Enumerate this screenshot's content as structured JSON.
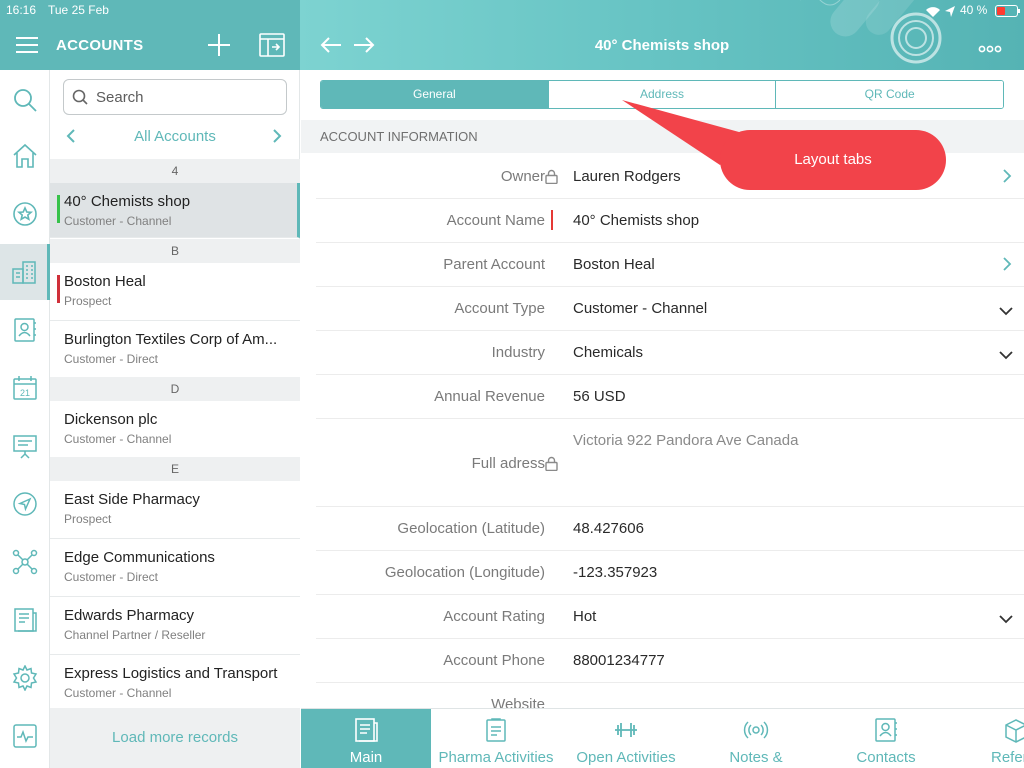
{
  "status_bar": {
    "time": "16:16",
    "date": "Tue 25 Feb",
    "battery": "40 %"
  },
  "header": {
    "left_title": "ACCOUNTS",
    "detail_title": "40° Chemists shop"
  },
  "list": {
    "search_placeholder": "Search",
    "filter_label": "All Accounts",
    "sections": [
      "4",
      "B",
      "D",
      "E"
    ],
    "rows": [
      {
        "name": "40° Chemists shop",
        "sub": "Customer - Channel"
      },
      {
        "name": "Boston Heal",
        "sub": "Prospect"
      },
      {
        "name": "Burlington Textiles Corp of Am...",
        "sub": "Customer - Direct"
      },
      {
        "name": "Dickenson plc",
        "sub": "Customer - Channel"
      },
      {
        "name": "East Side Pharmacy",
        "sub": "Prospect"
      },
      {
        "name": "Edge Communications",
        "sub": "Customer - Direct"
      },
      {
        "name": "Edwards Pharmacy",
        "sub": "Channel Partner / Reseller"
      },
      {
        "name": "Express Logistics and Transport",
        "sub": "Customer - Channel"
      }
    ],
    "load_more": "Load more records"
  },
  "tabs": [
    "General",
    "Address",
    "QR Code"
  ],
  "section_title": "ACCOUNT INFORMATION",
  "fields": [
    {
      "label": "Owner",
      "value": "Lauren Rodgers"
    },
    {
      "label": "Account Name",
      "value": "40° Chemists shop"
    },
    {
      "label": "Parent Account",
      "value": "Boston Heal"
    },
    {
      "label": "Account Type",
      "value": "Customer - Channel"
    },
    {
      "label": "Industry",
      "value": "Chemicals"
    },
    {
      "label": "Annual Revenue",
      "value": "56 USD"
    },
    {
      "label": "Full adress",
      "value": "Victoria 922 Pandora Ave Canada"
    },
    {
      "label": "Geolocation (Latitude)",
      "value": "48.427606"
    },
    {
      "label": "Geolocation (Longitude)",
      "value": "-123.357923"
    },
    {
      "label": "Account Rating",
      "value": "Hot"
    },
    {
      "label": "Account Phone",
      "value": "88001234777"
    },
    {
      "label": "Website",
      "value": ""
    }
  ],
  "callout": "Layout tabs",
  "bottom_tabs": [
    "Main",
    "Pharma Activities",
    "Open Activities",
    "Notes &",
    "Contacts",
    "Referer"
  ],
  "colors": {
    "teal": "#5fb8b8",
    "callout_red": "#f2434a",
    "required_red": "#e53935",
    "prospect_red": "#d0303a",
    "active_green": "#37c24a"
  },
  "icons": {
    "rail": [
      "search-icon",
      "home-icon",
      "favorites-icon",
      "accounts-icon",
      "contacts-icon",
      "calendar-icon",
      "presentation-icon",
      "navigation-icon",
      "network-icon",
      "reports-icon",
      "settings-icon",
      "activity-icon"
    ],
    "calendar_day": "21"
  }
}
